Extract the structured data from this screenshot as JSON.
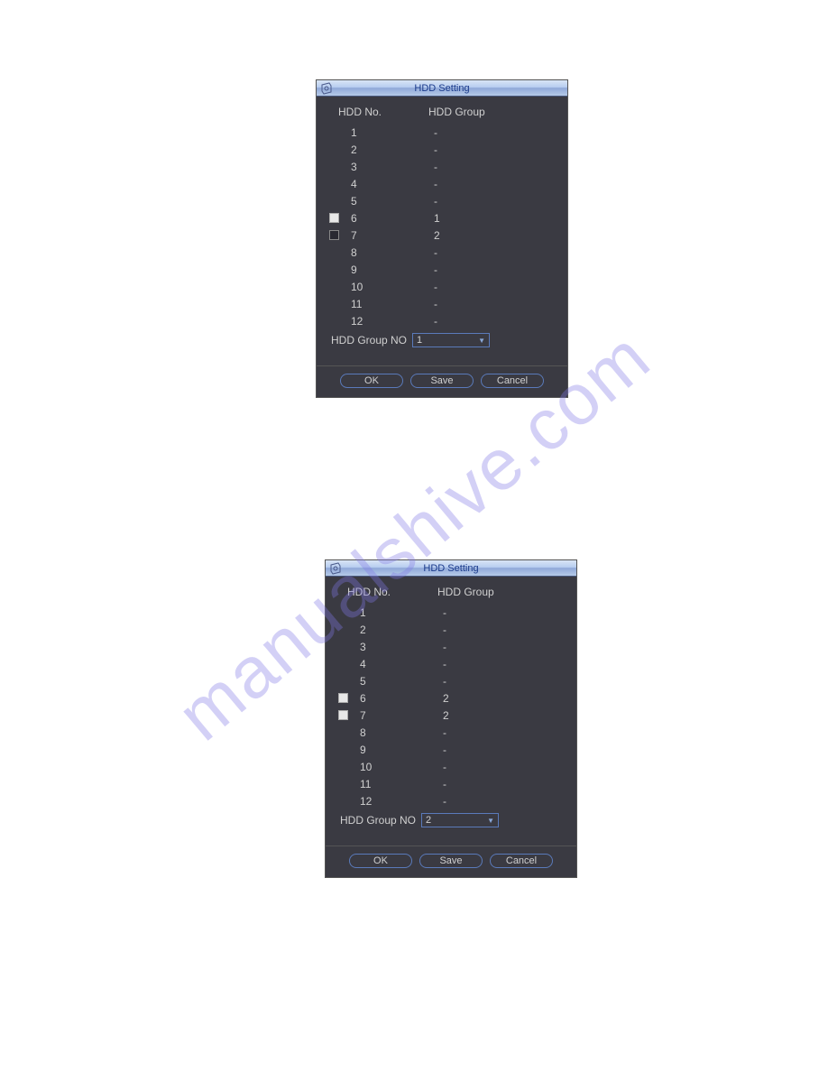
{
  "watermark": "manualshive.com",
  "dialog1": {
    "title": "HDD Setting",
    "headers": {
      "no": "HDD No.",
      "group": "HDD Group"
    },
    "rows": [
      {
        "no": "1",
        "group": "-",
        "checkbox": null
      },
      {
        "no": "2",
        "group": "-",
        "checkbox": null
      },
      {
        "no": "3",
        "group": "-",
        "checkbox": null
      },
      {
        "no": "4",
        "group": "-",
        "checkbox": null
      },
      {
        "no": "5",
        "group": "-",
        "checkbox": null
      },
      {
        "no": "6",
        "group": "1",
        "checkbox": "checked"
      },
      {
        "no": "7",
        "group": "2",
        "checkbox": "unchecked"
      },
      {
        "no": "8",
        "group": "-",
        "checkbox": null
      },
      {
        "no": "9",
        "group": "-",
        "checkbox": null
      },
      {
        "no": "10",
        "group": "-",
        "checkbox": null
      },
      {
        "no": "11",
        "group": "-",
        "checkbox": null
      },
      {
        "no": "12",
        "group": "-",
        "checkbox": null
      }
    ],
    "group_no_label": "HDD Group NO",
    "group_no_value": "1",
    "buttons": {
      "ok": "OK",
      "save": "Save",
      "cancel": "Cancel"
    }
  },
  "dialog2": {
    "title": "HDD Setting",
    "headers": {
      "no": "HDD No.",
      "group": "HDD Group"
    },
    "rows": [
      {
        "no": "1",
        "group": "-",
        "checkbox": null
      },
      {
        "no": "2",
        "group": "-",
        "checkbox": null
      },
      {
        "no": "3",
        "group": "-",
        "checkbox": null
      },
      {
        "no": "4",
        "group": "-",
        "checkbox": null
      },
      {
        "no": "5",
        "group": "-",
        "checkbox": null
      },
      {
        "no": "6",
        "group": "2",
        "checkbox": "checked"
      },
      {
        "no": "7",
        "group": "2",
        "checkbox": "checked"
      },
      {
        "no": "8",
        "group": "-",
        "checkbox": null
      },
      {
        "no": "9",
        "group": "-",
        "checkbox": null
      },
      {
        "no": "10",
        "group": "-",
        "checkbox": null
      },
      {
        "no": "11",
        "group": "-",
        "checkbox": null
      },
      {
        "no": "12",
        "group": "-",
        "checkbox": null
      }
    ],
    "group_no_label": "HDD Group NO",
    "group_no_value": "2",
    "buttons": {
      "ok": "OK",
      "save": "Save",
      "cancel": "Cancel"
    }
  }
}
